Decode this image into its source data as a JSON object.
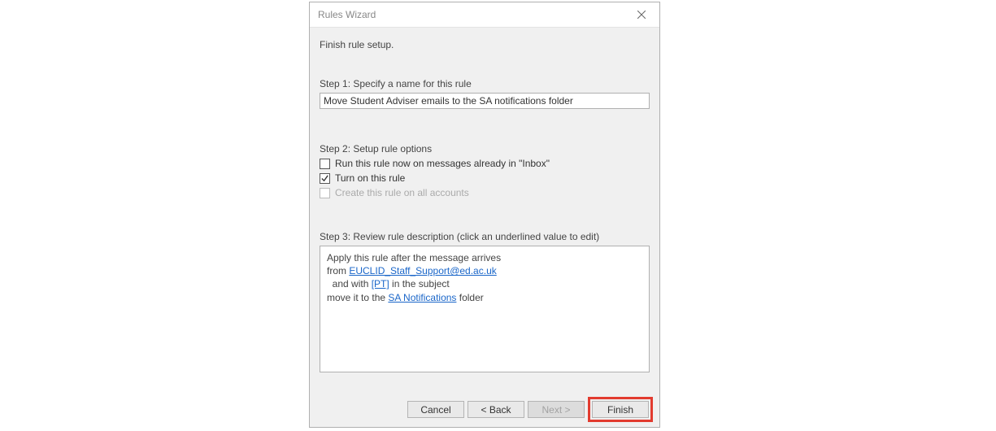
{
  "window": {
    "title": "Rules Wizard"
  },
  "header": {
    "subtitle": "Finish rule setup."
  },
  "step1": {
    "label": "Step 1: Specify a name for this rule",
    "value": "Move Student Adviser emails to the SA notifications folder"
  },
  "step2": {
    "label": "Step 2: Setup rule options",
    "opt_run_now": "Run this rule now on messages already in \"Inbox\"",
    "opt_turn_on": "Turn on this rule",
    "opt_all_accounts": "Create this rule on all accounts"
  },
  "step3": {
    "label": "Step 3: Review rule description (click an underlined value to edit)",
    "line1": "Apply this rule after the message arrives",
    "line2_prefix": "from ",
    "line2_link": "EUCLID_Staff_Support@ed.ac.uk",
    "line3_prefix": "  and with ",
    "line3_link": "[PT]",
    "line3_suffix": " in the subject",
    "line4_prefix": "move it to the ",
    "line4_link": "SA Notifications",
    "line4_suffix": " folder"
  },
  "buttons": {
    "cancel": "Cancel",
    "back": "< Back",
    "next": "Next >",
    "finish": "Finish"
  }
}
